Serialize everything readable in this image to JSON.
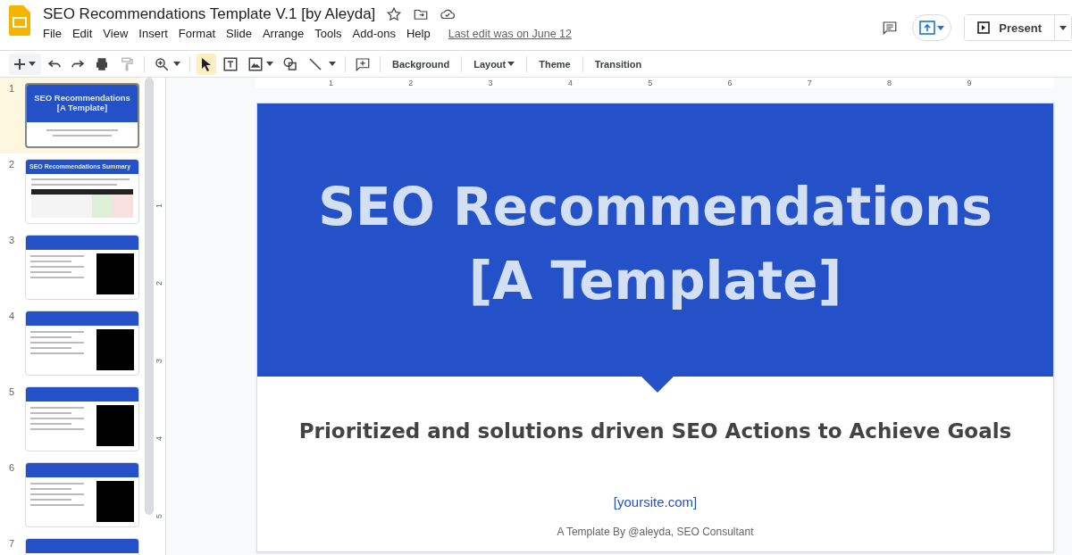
{
  "document": {
    "title": "SEO Recommendations Template V.1 [by Aleyda]",
    "last_edit": "Last edit was on June 12"
  },
  "menu": [
    "File",
    "Edit",
    "View",
    "Insert",
    "Format",
    "Slide",
    "Arrange",
    "Tools",
    "Add-ons",
    "Help"
  ],
  "present_button": "Present",
  "toolbar": {
    "buttons": [
      "Background",
      "Layout",
      "Theme",
      "Transition"
    ],
    "select_tool_active": true
  },
  "filmstrip": [
    {
      "number": "1",
      "selected": true,
      "kind": "title",
      "title": "SEO Recommendations [A Template]"
    },
    {
      "number": "2",
      "selected": false,
      "kind": "table",
      "title": "SEO Recommendations Summary"
    },
    {
      "number": "3",
      "selected": false,
      "kind": "content"
    },
    {
      "number": "4",
      "selected": false,
      "kind": "content"
    },
    {
      "number": "5",
      "selected": false,
      "kind": "content"
    },
    {
      "number": "6",
      "selected": false,
      "kind": "content"
    },
    {
      "number": "7",
      "selected": false,
      "kind": "header_only"
    }
  ],
  "ruler": {
    "horizontal": [
      "1",
      "2",
      "3",
      "4",
      "5",
      "6",
      "7",
      "8",
      "9"
    ],
    "vertical": [
      "1",
      "2",
      "3",
      "4",
      "5"
    ]
  },
  "slide": {
    "title_lines": [
      "SEO Recommendations",
      "[A Template]"
    ],
    "subtitle": "Prioritized and solutions driven SEO Actions to Achieve Goals",
    "link": "[yoursite.com]",
    "footer": "A Template By @aleyda, SEO Consultant"
  }
}
